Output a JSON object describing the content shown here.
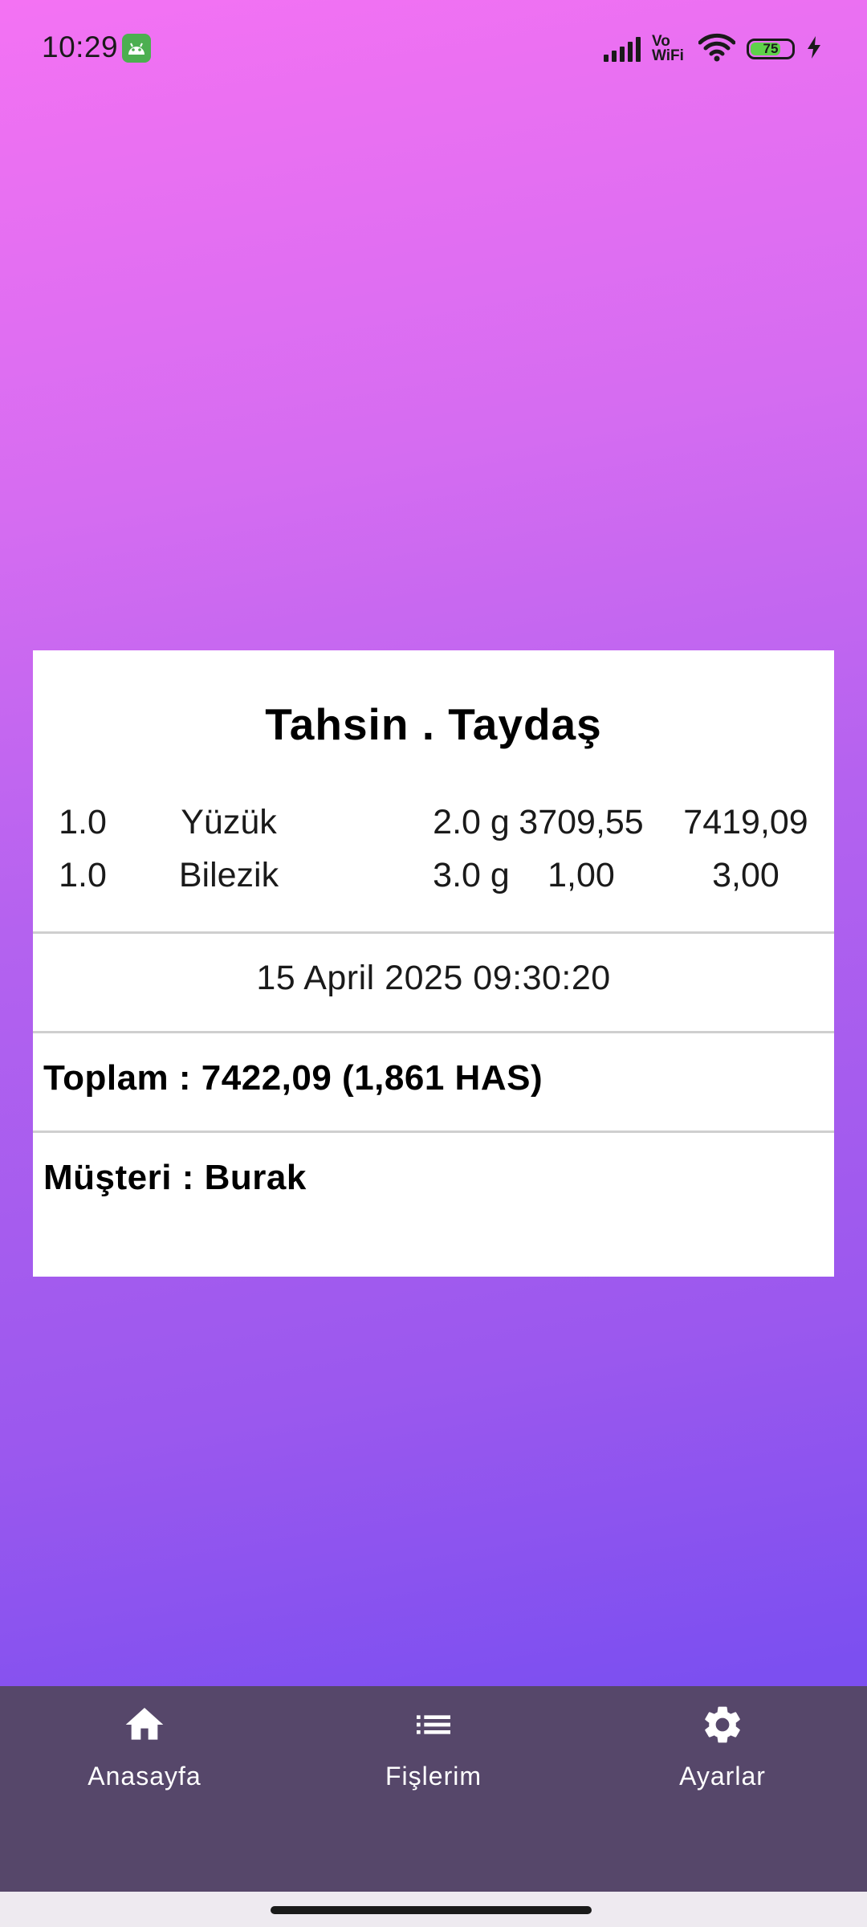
{
  "status_bar": {
    "time": "10:29",
    "network_label_top": "Vo",
    "network_label_bottom": "WiFi",
    "battery_level": "75",
    "battery_fraction": 0.75,
    "notification_icon": "android-robot-icon"
  },
  "receipt": {
    "title": "Tahsin . Taydaş",
    "items": [
      {
        "qty": "1.0",
        "name": "Yüzük",
        "gram": "2.0 g",
        "price": "3709,55",
        "total": "7419,09"
      },
      {
        "qty": "1.0",
        "name": "Bilezik",
        "gram": "3.0 g",
        "price": "1,00",
        "total": "3,00"
      }
    ],
    "date": "15 April 2025 09:30:20",
    "total": "Toplam : 7422,09 (1,861 HAS)",
    "customer": "Müşteri : Burak"
  },
  "bottom_nav": {
    "items": [
      {
        "label": "Anasayfa",
        "icon": "home-icon"
      },
      {
        "label": "Fişlerim",
        "icon": "list-icon"
      },
      {
        "label": "Ayarlar",
        "icon": "settings-icon"
      }
    ]
  },
  "colors": {
    "gradient_top": "#f472f3",
    "gradient_bottom": "#7a4ef0",
    "nav_background": "#56476a",
    "receipt_background": "#ffffff"
  }
}
